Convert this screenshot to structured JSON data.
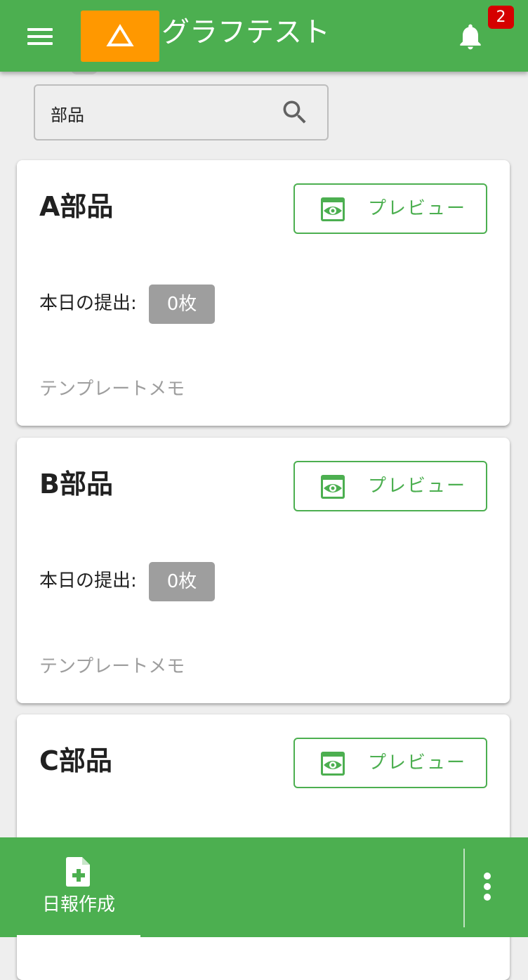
{
  "header": {
    "title": "グラフテスト",
    "notification_count": "2",
    "menu_icon": "hamburger-menu-icon",
    "logo_icon": "triangle-logo-icon",
    "bell_icon": "bell-icon"
  },
  "search": {
    "value": "部品",
    "icon": "search-icon"
  },
  "cards": [
    {
      "title": "A部品",
      "preview_label": "プレビュー",
      "submission_label": "本日の提出:",
      "submission_count": "0枚",
      "memo": "テンプレートメモ"
    },
    {
      "title": "B部品",
      "preview_label": "プレビュー",
      "submission_label": "本日の提出:",
      "submission_count": "0枚",
      "memo": "テンプレートメモ"
    },
    {
      "title": "C部品",
      "preview_label": "プレビュー"
    }
  ],
  "bottom_nav": {
    "create_label": "日報作成",
    "create_icon": "add-document-icon",
    "more_icon": "more-vertical-icon"
  },
  "colors": {
    "primary": "#4caf50",
    "logo": "#ff9800",
    "badge": "#d50000",
    "chip": "#9e9e9e",
    "background": "#eeeeee"
  }
}
